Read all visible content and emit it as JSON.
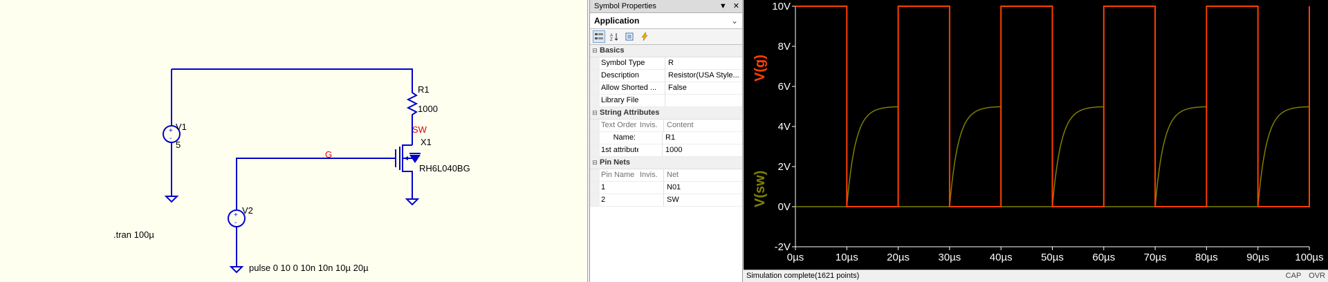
{
  "schematic": {
    "components": {
      "v1": {
        "name": "V1",
        "value": "5"
      },
      "v2": {
        "name": "V2",
        "value": "pulse 0 10 0 10n 10n 10µ 20µ"
      },
      "r1": {
        "name": "R1",
        "value": "1000"
      },
      "x1": {
        "name": "X1",
        "value": "RH6L040BG"
      }
    },
    "nets": {
      "sw": "SW",
      "g": "G"
    },
    "directive": ".tran 100µ"
  },
  "properties": {
    "panel_title": "Symbol Properties",
    "category": "Application",
    "sections": {
      "basics": "Basics",
      "string_attributes": "String Attributes",
      "pin_nets": "Pin Nets"
    },
    "basics": [
      {
        "key": "Symbol Type",
        "value": "R"
      },
      {
        "key": "Description",
        "value": "Resistor(USA Style..."
      },
      {
        "key": "Allow Shorted ...",
        "value": "False"
      },
      {
        "key": "Library File",
        "value": ""
      }
    ],
    "string_attributes": {
      "headers": [
        "Text Order",
        "Invis.",
        "Content"
      ],
      "rows": [
        {
          "name": "Name:",
          "invis": "",
          "content": "R1"
        },
        {
          "name": "1st attribute",
          "invis": "",
          "content": "1000"
        }
      ]
    },
    "pin_nets": {
      "headers": [
        "Pin Name",
        "Invis.",
        "Net"
      ],
      "rows": [
        {
          "pin": "1",
          "invis": "",
          "net": "N01"
        },
        {
          "pin": "2",
          "invis": "",
          "net": "SW"
        }
      ]
    }
  },
  "waveform": {
    "y_ticks": [
      "10V",
      "8V",
      "6V",
      "4V",
      "2V",
      "0V",
      "-2V"
    ],
    "x_ticks": [
      "0µs",
      "10µs",
      "20µs",
      "30µs",
      "40µs",
      "50µs",
      "60µs",
      "70µs",
      "80µs",
      "90µs",
      "100µs"
    ],
    "traces": {
      "g": "V(g)",
      "sw": "V(sw)"
    },
    "colors": {
      "g": "#ff4000",
      "sw": "#808000",
      "axis": "#ffffff",
      "background": "#000000"
    }
  },
  "status": {
    "message": "Simulation complete(1621 points)",
    "indicators": [
      "CAP",
      "OVR"
    ]
  }
}
